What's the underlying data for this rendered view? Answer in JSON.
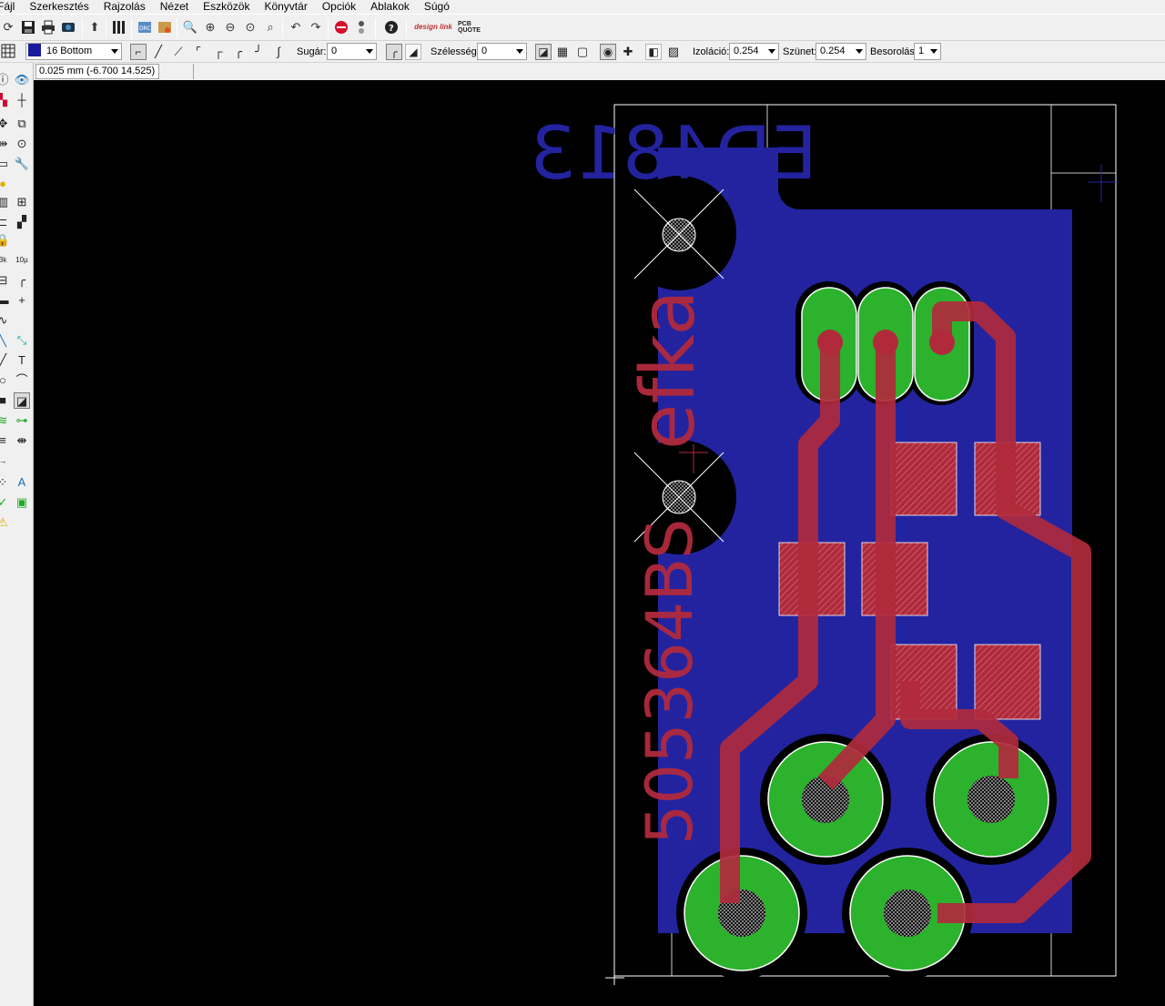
{
  "menu": [
    "Fájl",
    "Szerkesztés",
    "Rajzolás",
    "Nézet",
    "Eszközök",
    "Könyvtár",
    "Opciók",
    "Ablakok",
    "Súgó"
  ],
  "toolbar_main": {
    "icons": [
      "open-script-icon",
      "save-icon",
      "print-icon",
      "cam-icon",
      "board-schematic-switch-icon",
      "layer-settings-icon",
      "zoom-fit-icon",
      "zoom-in-icon",
      "zoom-out-icon",
      "zoom-redraw-icon",
      "zoom-select-icon",
      "undo-icon",
      "redo-icon",
      "stop-icon",
      "go-icon",
      "help-icon"
    ],
    "design_link_label": "design link",
    "pcb_quote_label": "PCB QUOTE"
  },
  "param_bar": {
    "layer_value": "16 Bottom",
    "layer_color": "#1a1a9e",
    "radius_label": "Sugár:",
    "radius_value": "0",
    "width_label": "Szélesség:",
    "width_value": "0",
    "isolation_label": "Izoláció:",
    "isolation_value": "0.254",
    "spacing_label": "Szünet:",
    "spacing_value": "0.254",
    "rank_label": "Besorolás:",
    "rank_value": "1"
  },
  "coord_readout": "0.025 mm (-6.700 14.525)",
  "board": {
    "layer_texts": {
      "bottom_name": "ED4813",
      "top_name": "efka",
      "part_number": "505364BS"
    },
    "colors": {
      "background": "#000000",
      "bottom_copper": "#2323a0",
      "top_copper": "#b02a3c",
      "pad": "#2cb22c",
      "outline": "#ffffff"
    }
  }
}
